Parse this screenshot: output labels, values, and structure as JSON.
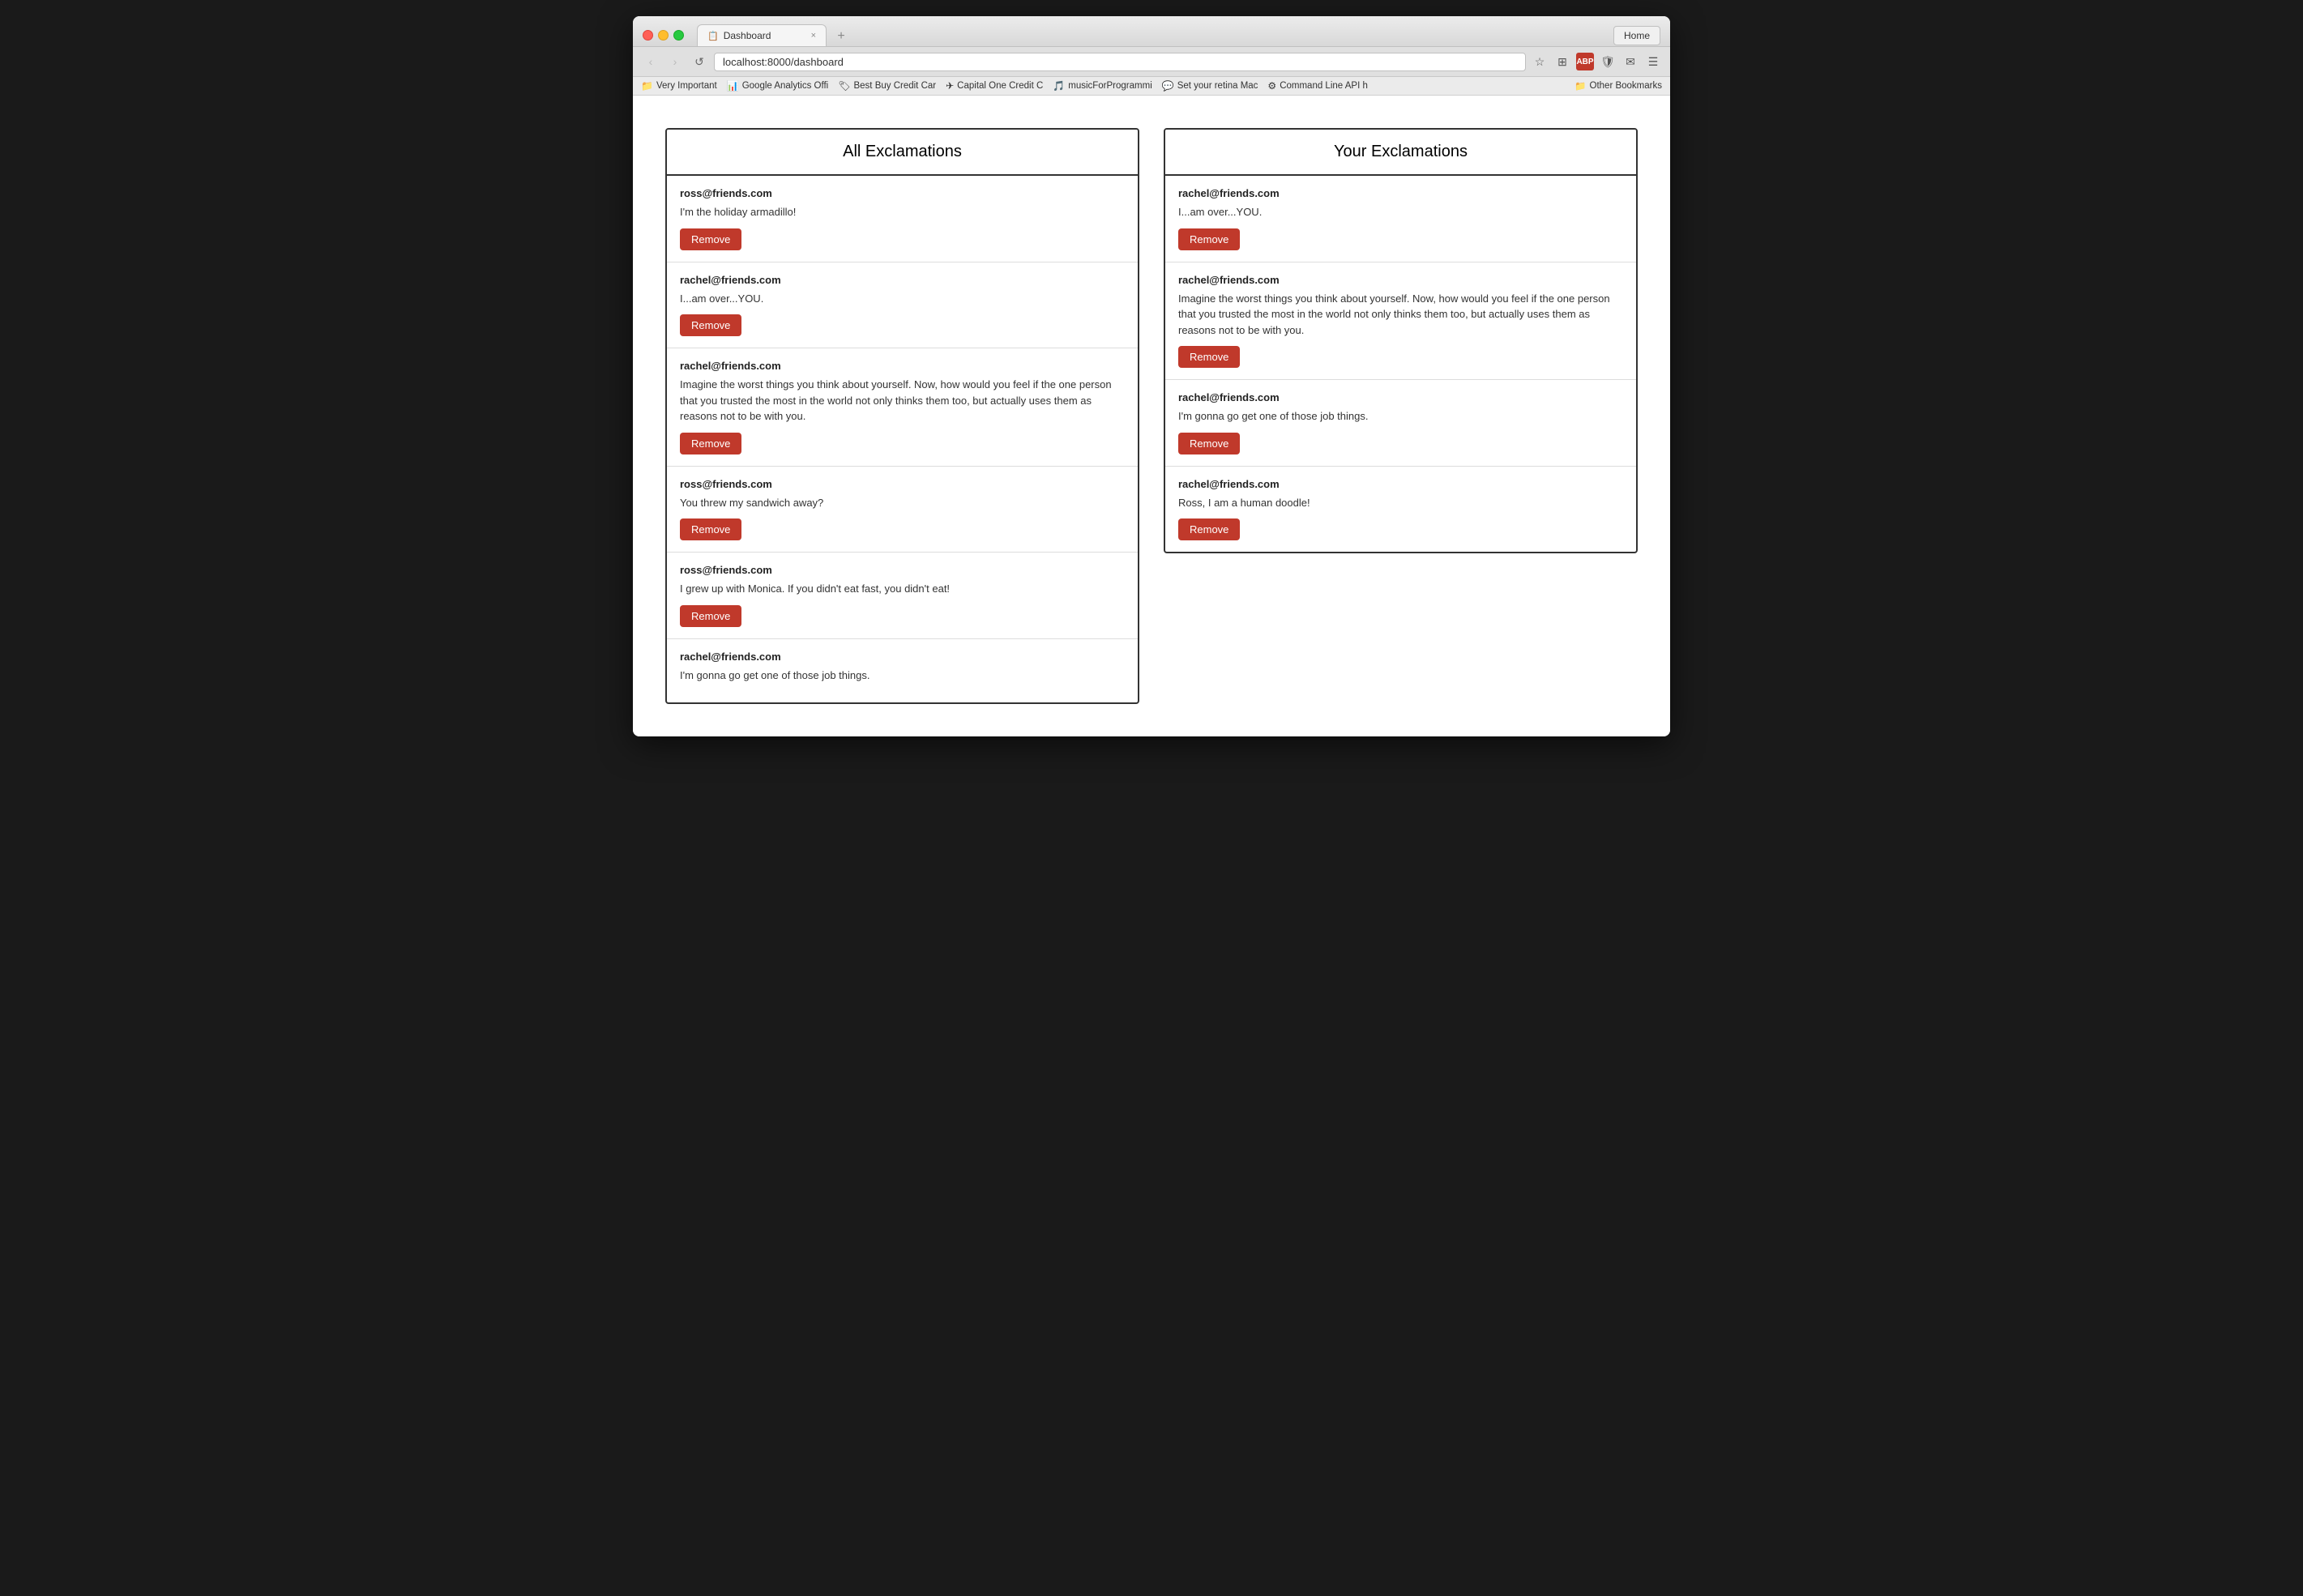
{
  "browser": {
    "tab_title": "Dashboard",
    "tab_icon": "📋",
    "close_label": "×",
    "new_tab_label": "+",
    "home_label": "Home",
    "back_label": "‹",
    "forward_label": "›",
    "refresh_label": "↺",
    "address": "localhost:8000/dashboard",
    "bookmarks": [
      {
        "icon": "📁",
        "label": "Very Important"
      },
      {
        "icon": "📊",
        "label": "Google Analytics Offi"
      },
      {
        "icon": "🏪",
        "label": "Best Buy Credit Car"
      },
      {
        "icon": "✈",
        "label": "Capital One Credit C"
      },
      {
        "icon": "m",
        "label": "musicForProgrammi"
      },
      {
        "icon": "💬",
        "label": "Set your retina Mac"
      },
      {
        "icon": "⚙",
        "label": "Command Line API h"
      }
    ],
    "bookmarks_other_label": "Other Bookmarks",
    "bookmarks_other_icon": "📁"
  },
  "page": {
    "all_column_title": "All Exclamations",
    "your_column_title": "Your Exclamations",
    "remove_label": "Remove",
    "all_items": [
      {
        "email": "ross@friends.com",
        "text": "I'm the holiday armadillo!"
      },
      {
        "email": "rachel@friends.com",
        "text": "I...am over...YOU."
      },
      {
        "email": "rachel@friends.com",
        "text": "Imagine the worst things you think about yourself. Now, how would you feel if the one person that you trusted the most in the world not only thinks them too, but actually uses them as reasons not to be with you."
      },
      {
        "email": "ross@friends.com",
        "text": "You threw my sandwich away?"
      },
      {
        "email": "ross@friends.com",
        "text": "I grew up with Monica. If you didn't eat fast, you didn't eat!"
      },
      {
        "email": "rachel@friends.com",
        "text": "I'm gonna go get one of those job things."
      }
    ],
    "your_items": [
      {
        "email": "rachel@friends.com",
        "text": "I...am over...YOU."
      },
      {
        "email": "rachel@friends.com",
        "text": "Imagine the worst things you think about yourself. Now, how would you feel if the one person that you trusted the most in the world not only thinks them too, but actually uses them as reasons not to be with you."
      },
      {
        "email": "rachel@friends.com",
        "text": "I'm gonna go get one of those job things."
      },
      {
        "email": "rachel@friends.com",
        "text": "Ross, I am a human doodle!"
      }
    ]
  }
}
